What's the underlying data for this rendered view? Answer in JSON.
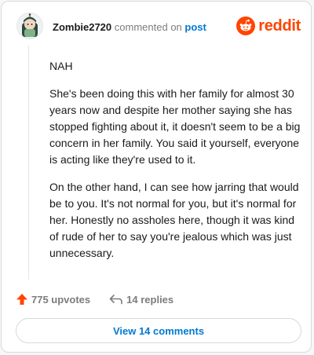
{
  "header": {
    "username": "Zombie2720",
    "commented_text": "commented on",
    "post_link": "post",
    "brand": "reddit"
  },
  "comment": {
    "paragraphs": [
      "NAH",
      "She's been doing this with her family for almost 30 years now and despite her mother saying she has stopped fighting about it, it doesn't seem to be a big concern in her family. You said it yourself, everyone is acting like they're used to it.",
      "On the other hand, I can see how jarring that would be to you. It's not normal for you, but it's normal for her. Honestly no assholes here, though it was kind of rude of her to say you're jealous which was just unnecessary."
    ]
  },
  "actions": {
    "upvotes": "775 upvotes",
    "replies": "14 replies"
  },
  "footer": {
    "view_comments": "View 14 comments"
  },
  "colors": {
    "brand_orange": "#ff4500",
    "link_blue": "#0079d3",
    "muted_gray": "#7c7c7c"
  },
  "icons": {
    "avatar": "avatar-icon",
    "reddit_logo": "reddit-logo-icon",
    "upvote": "upvote-arrow-icon",
    "reply": "reply-arrow-icon"
  }
}
